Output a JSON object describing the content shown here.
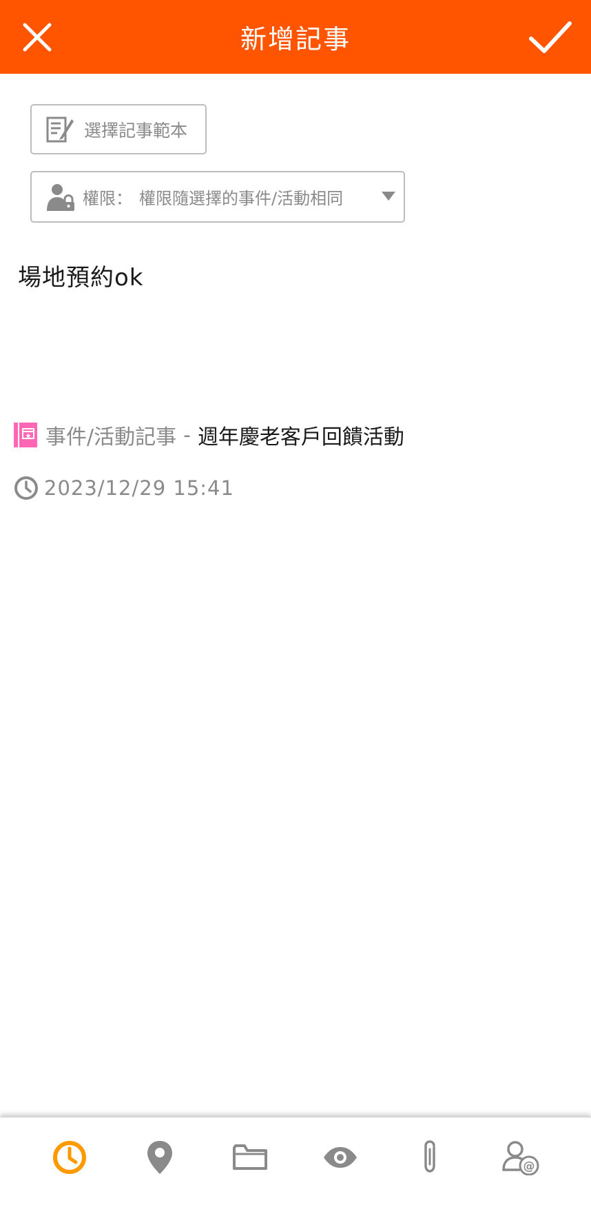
{
  "header": {
    "title": "新增記事",
    "bg_color": "#ff5500"
  },
  "template_button": {
    "label": "選擇記事範本"
  },
  "permission": {
    "label": "權限：",
    "value": "權限隨選擇的事件/活動相同"
  },
  "note": {
    "content": "場地預約ok"
  },
  "event": {
    "category": "事件/活動記事",
    "separator": "-",
    "name": "週年慶老客戶回饋活動",
    "icon_color": "#ff66b3"
  },
  "timestamp": {
    "value": "2023/12/29 15:41"
  },
  "toolbar": {
    "active_color": "#ff9900",
    "inactive_color": "#8a8a8a",
    "items": [
      {
        "icon": "clock-icon",
        "active": true
      },
      {
        "icon": "location-pin-icon",
        "active": false
      },
      {
        "icon": "folder-icon",
        "active": false
      },
      {
        "icon": "eye-icon",
        "active": false
      },
      {
        "icon": "paperclip-icon",
        "active": false
      },
      {
        "icon": "mention-user-icon",
        "active": false
      }
    ]
  }
}
